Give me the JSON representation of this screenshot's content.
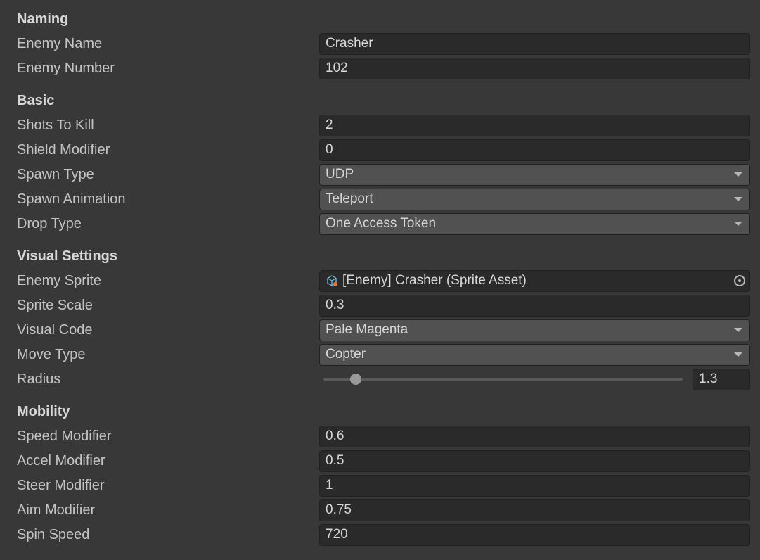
{
  "sections": {
    "naming": {
      "header": "Naming",
      "enemy_name": {
        "label": "Enemy Name",
        "value": "Crasher"
      },
      "enemy_number": {
        "label": "Enemy Number",
        "value": "102"
      }
    },
    "basic": {
      "header": "Basic",
      "shots_to_kill": {
        "label": "Shots To Kill",
        "value": "2"
      },
      "shield_modifier": {
        "label": "Shield Modifier",
        "value": "0"
      },
      "spawn_type": {
        "label": "Spawn Type",
        "value": "UDP"
      },
      "spawn_animation": {
        "label": "Spawn Animation",
        "value": "Teleport"
      },
      "drop_type": {
        "label": "Drop Type",
        "value": "One Access Token"
      }
    },
    "visual": {
      "header": "Visual Settings",
      "enemy_sprite": {
        "label": "Enemy Sprite",
        "value": "[Enemy] Crasher (Sprite Asset)"
      },
      "sprite_scale": {
        "label": "Sprite Scale",
        "value": "0.3"
      },
      "visual_code": {
        "label": "Visual Code",
        "value": "Pale Magenta"
      },
      "move_type": {
        "label": "Move Type",
        "value": "Copter"
      },
      "radius": {
        "label": "Radius",
        "value": "1.3",
        "percent": 9
      }
    },
    "mobility": {
      "header": "Mobility",
      "speed_modifier": {
        "label": "Speed Modifier",
        "value": "0.6"
      },
      "accel_modifier": {
        "label": "Accel Modifier",
        "value": "0.5"
      },
      "steer_modifier": {
        "label": "Steer Modifier",
        "value": "1"
      },
      "aim_modifier": {
        "label": "Aim Modifier",
        "value": "0.75"
      },
      "spin_speed": {
        "label": "Spin Speed",
        "value": "720"
      }
    }
  }
}
